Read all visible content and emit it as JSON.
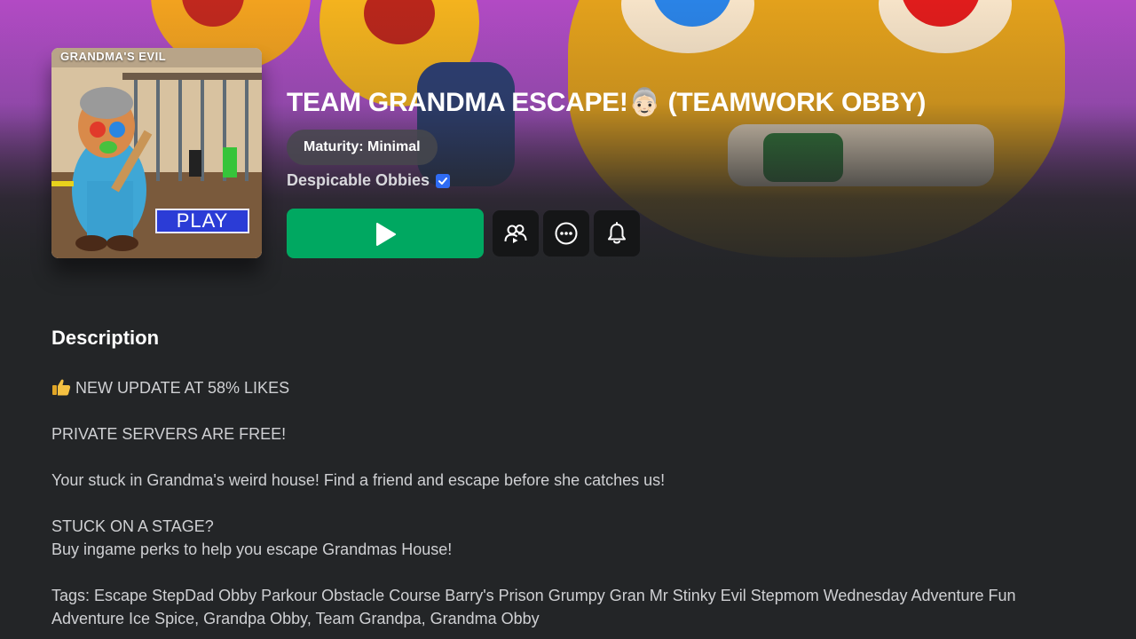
{
  "game": {
    "title": "TEAM GRANDMA ESCAPE!👵🏻 (TEAMWORK OBBY)",
    "maturity": "Maturity: Minimal",
    "creator": "Despicable Obbies",
    "thumbnail_top_text": "GRANDMA'S EVIL",
    "thumbnail_play_label": "PLAY"
  },
  "description": {
    "heading": "Description",
    "lines": [
      "NEW UPDATE AT 58% LIKES",
      "PRIVATE SERVERS ARE FREE!",
      "Your stuck in Grandma's weird house! Find a friend and escape before she catches us!",
      "STUCK ON A STAGE?",
      "Buy ingame perks to help you escape Grandmas House!",
      "Tags: Escape StepDad Obby Parkour Obstacle Course Barry's Prison Grumpy Gran Mr Stinky Evil Stepmom Wednesday Adventure Fun",
      "Adventure Ice Spice, Grandpa Obby, Team Grandpa, Grandma Obby"
    ]
  },
  "icons": {
    "play": "play-icon",
    "party": "party-icon",
    "more": "more-options-icon",
    "notify": "bell-icon",
    "verified": "verified-badge-icon",
    "likes": "thumbs-up-icon"
  },
  "colors": {
    "background": "#232527",
    "play_button": "#00a861",
    "icon_button": "#151617",
    "verified": "#2f6cf4"
  }
}
